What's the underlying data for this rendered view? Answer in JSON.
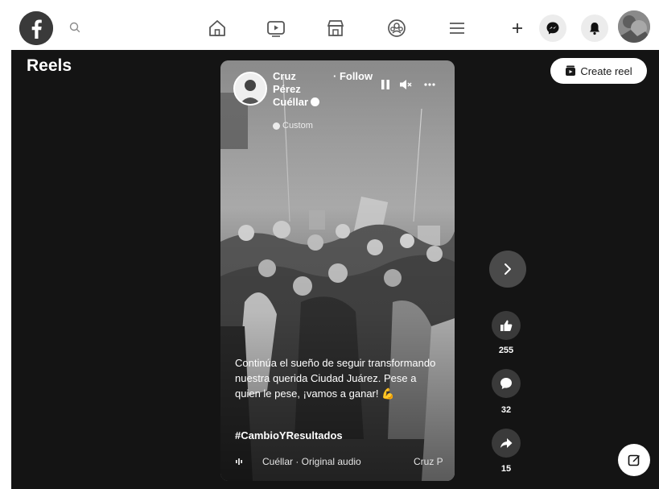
{
  "nav": {
    "logo_icon": "facebook-logo",
    "search_icon": "search-icon",
    "items": [
      {
        "name": "home",
        "icon": "home-icon"
      },
      {
        "name": "video",
        "icon": "video-icon"
      },
      {
        "name": "marketplace",
        "icon": "marketplace-icon"
      },
      {
        "name": "groups",
        "icon": "groups-icon"
      },
      {
        "name": "menu",
        "icon": "menu-icon"
      }
    ],
    "actions": [
      {
        "name": "create",
        "icon": "plus-icon"
      },
      {
        "name": "messenger",
        "icon": "messenger-icon"
      },
      {
        "name": "notifications",
        "icon": "bell-icon"
      }
    ]
  },
  "page": {
    "title": "Reels",
    "create_reel_label": "Create reel"
  },
  "reel": {
    "author_name": "Cruz Pérez Cuéllar",
    "author_verified": true,
    "audience": "Custom",
    "follow_label": "· Follow",
    "caption": "Continúa el sueño de seguir transformando nuestra querida Ciudad Juárez. Pese a quien le pese, ¡vamos a ganar! 💪",
    "hashtag": "#CambioYResultados",
    "audio_track": "Cuéllar · Original audio",
    "audio_author": "Cruz P"
  },
  "actions": {
    "likes": "255",
    "comments": "32",
    "shares": "15"
  },
  "colors": {
    "stage_bg": "#141414",
    "card_bg": "#7b7b7b"
  }
}
